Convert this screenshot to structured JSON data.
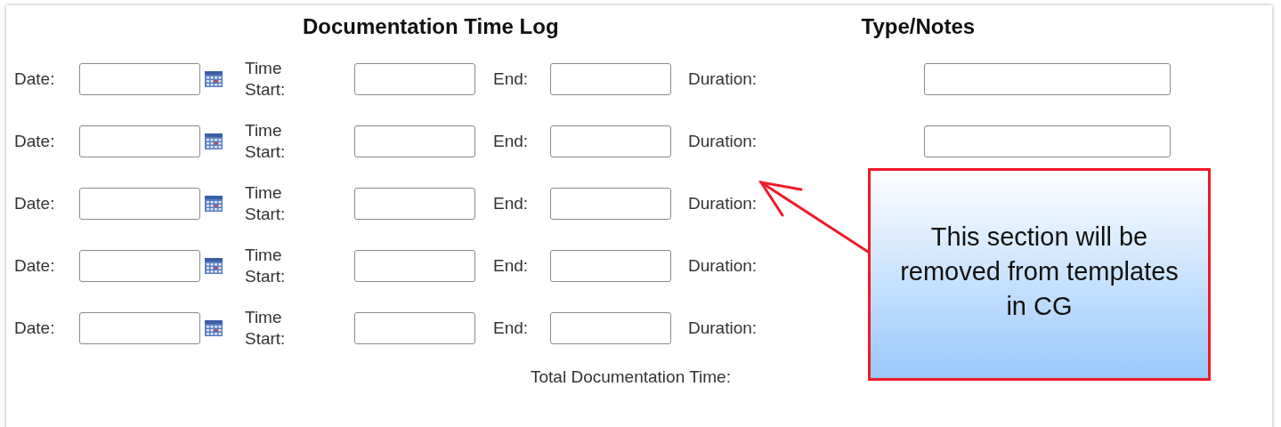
{
  "title": "Documentation Time Log",
  "notes_heading": "Type/Notes",
  "rows": [
    {
      "kind": "with_notes",
      "date_label": "Date:",
      "start_label_1": "Time",
      "start_label_2": "Start:",
      "end_label": "End:",
      "duration_label": "Duration:"
    },
    {
      "kind": "with_notes",
      "date_label": "Date:",
      "start_label_1": "Time",
      "start_label_2": "Start:",
      "end_label": "End:",
      "duration_label": "Duration:"
    },
    {
      "kind": "plain",
      "date_label": "Date:",
      "start_label_1": "Time",
      "start_label_2": "Start:",
      "end_label": "End:",
      "duration_label": "Duration:"
    },
    {
      "kind": "plain",
      "date_label": "Date:",
      "start_label_1": "Time",
      "start_label_2": "Start:",
      "end_label": "End:",
      "duration_label": "Duration:"
    },
    {
      "kind": "plain",
      "date_label": "Date:",
      "start_label_1": "Time",
      "start_label_2": "Start:",
      "end_label": "End:",
      "duration_label": "Duration:"
    }
  ],
  "total_label": "Total Documentation Time:",
  "callout": {
    "text": "This section will be removed from templates in CG"
  }
}
